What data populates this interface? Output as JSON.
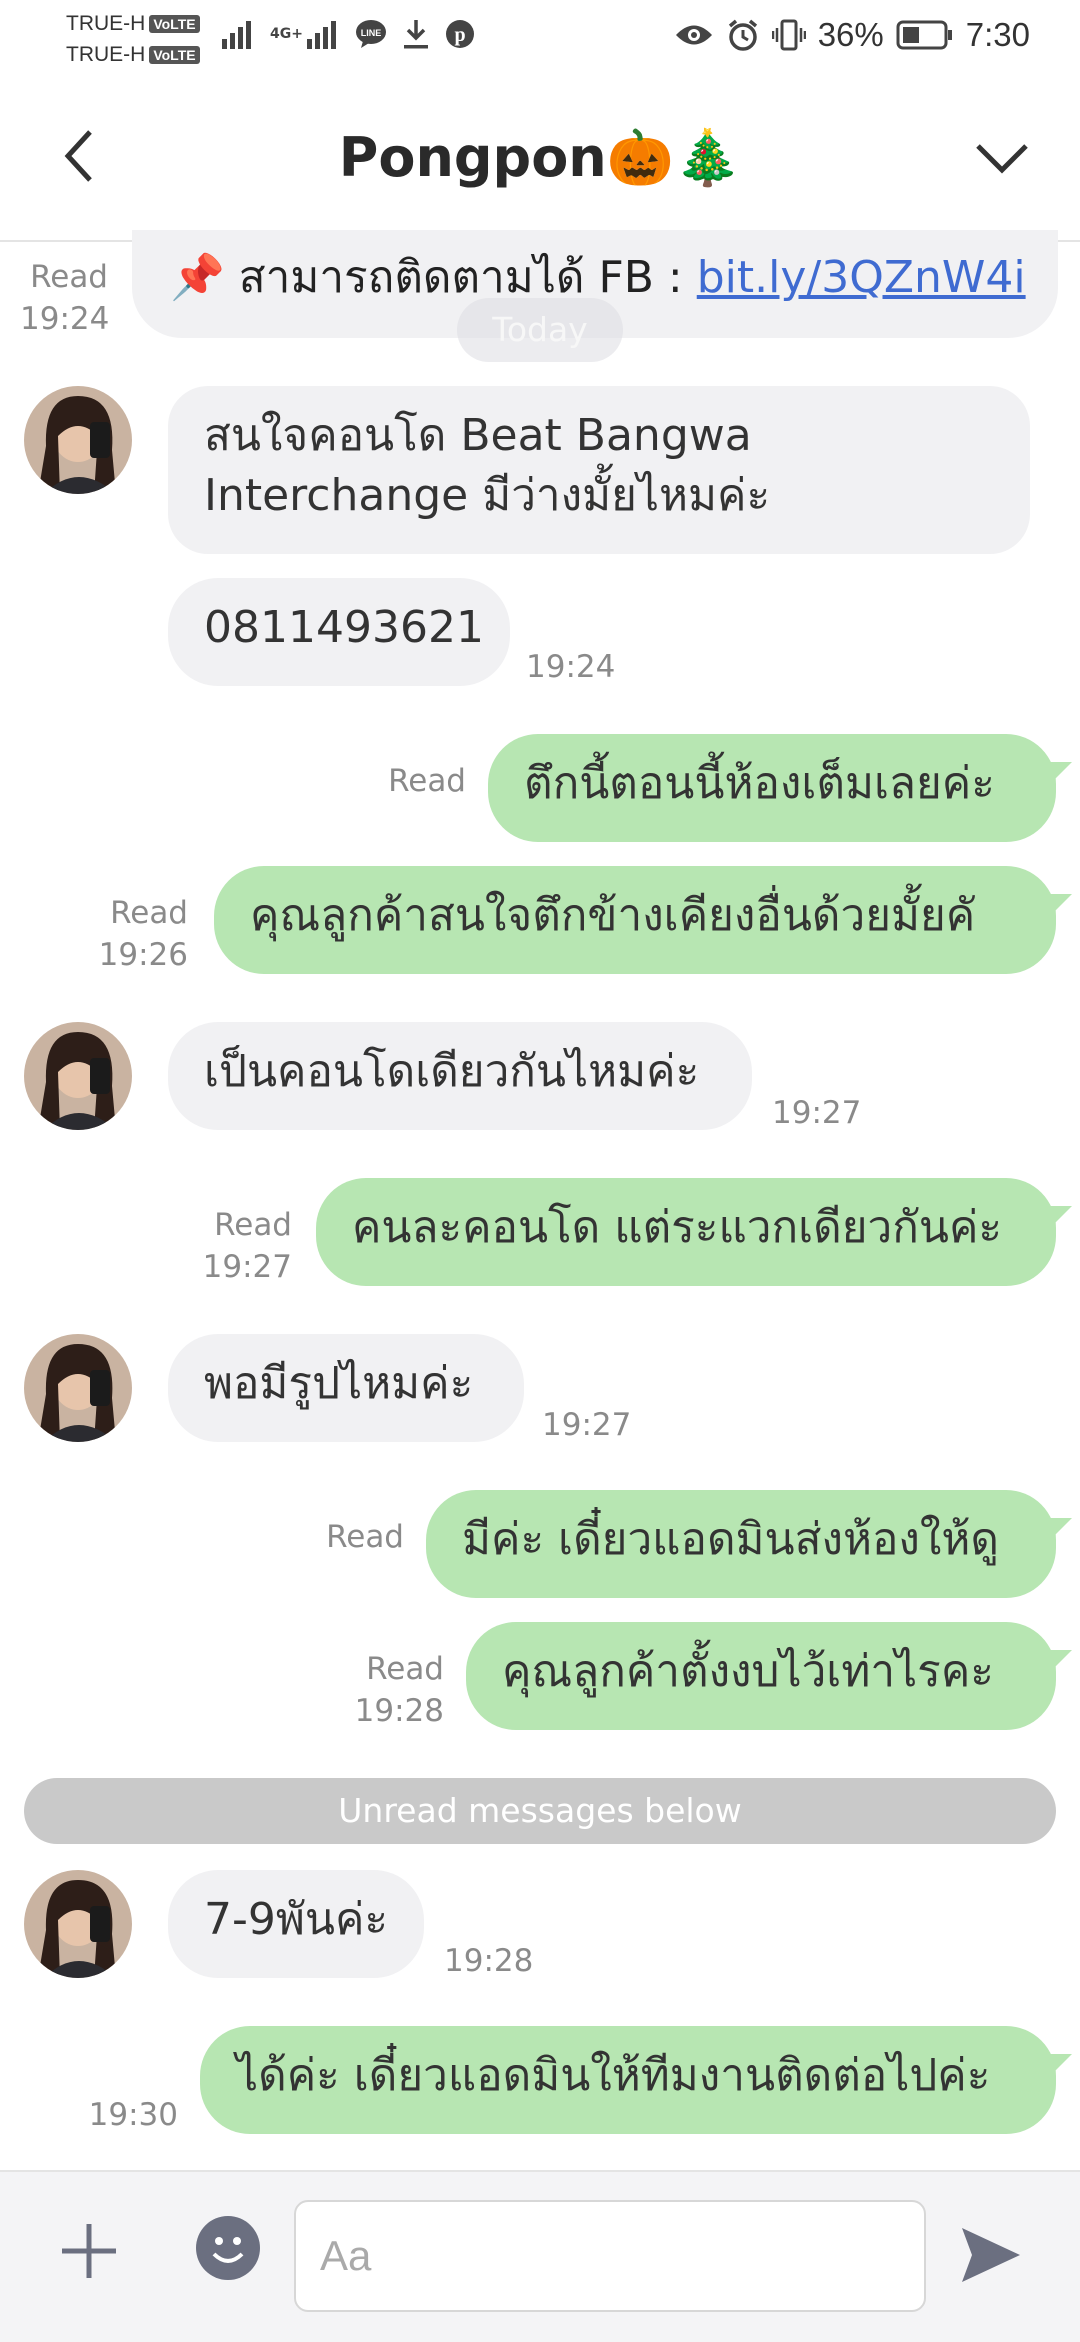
{
  "status_bar": {
    "carrier1": "TRUE-H",
    "carrier2": "TRUE-H",
    "volte": "VoLTE",
    "network": "4G+",
    "battery": "36%",
    "time": "7:30"
  },
  "header": {
    "title": "Pongpon🎃🎄"
  },
  "chat": {
    "prev_message": {
      "text": "📌 สามารถติดตามได้ FB : ",
      "link": "bit.ly/3QZnW4i",
      "read": "Read",
      "time": "19:24"
    },
    "today_label": "Today",
    "messages": [
      {
        "dir": "in",
        "line1": "สนใจคอนโด Beat Bangwa",
        "line2": "Interchange มีว่างมั้ยไหมค่ะ"
      },
      {
        "dir": "in",
        "text": "0811493621",
        "time": "19:24"
      },
      {
        "dir": "out",
        "text": "ตึกนี้ตอนนี้ห้องเต็มเลยค่ะ",
        "read": "Read"
      },
      {
        "dir": "out",
        "text": "คุณลูกค้าสนใจตึกข้างเคียงอื่นด้วยมั้ยคั",
        "read": "Read",
        "time": "19:26"
      },
      {
        "dir": "in",
        "text": "เป็นคอนโดเดียวกันไหมค่ะ",
        "time": "19:27"
      },
      {
        "dir": "out",
        "text": "คนละคอนโด แต่ระแวกเดียวกันค่ะ",
        "read": "Read",
        "time": "19:27"
      },
      {
        "dir": "in",
        "text": "พอมีรูปไหมค่ะ",
        "time": "19:27"
      },
      {
        "dir": "out",
        "text": "มีค่ะ เดี๋ยวแอดมินส่งห้องให้ดู",
        "read": "Read"
      },
      {
        "dir": "out",
        "text": "คุณลูกค้าตั้งงบไว้เท่าไรคะ",
        "read": "Read",
        "time": "19:28"
      },
      {
        "dir": "in",
        "text": "7-9พันค่ะ",
        "time": "19:28"
      },
      {
        "dir": "out",
        "text": "ได้ค่ะ เดี๋ยวแอดมินให้ทีมงานติดต่อไปค่ะ",
        "time": "19:30"
      }
    ],
    "unread_divider": "Unread messages below"
  },
  "composer": {
    "placeholder": "Aa"
  },
  "colors": {
    "outgoing": "#b7e6b2",
    "incoming": "#f1f1f3",
    "link": "#3f6bd1"
  }
}
